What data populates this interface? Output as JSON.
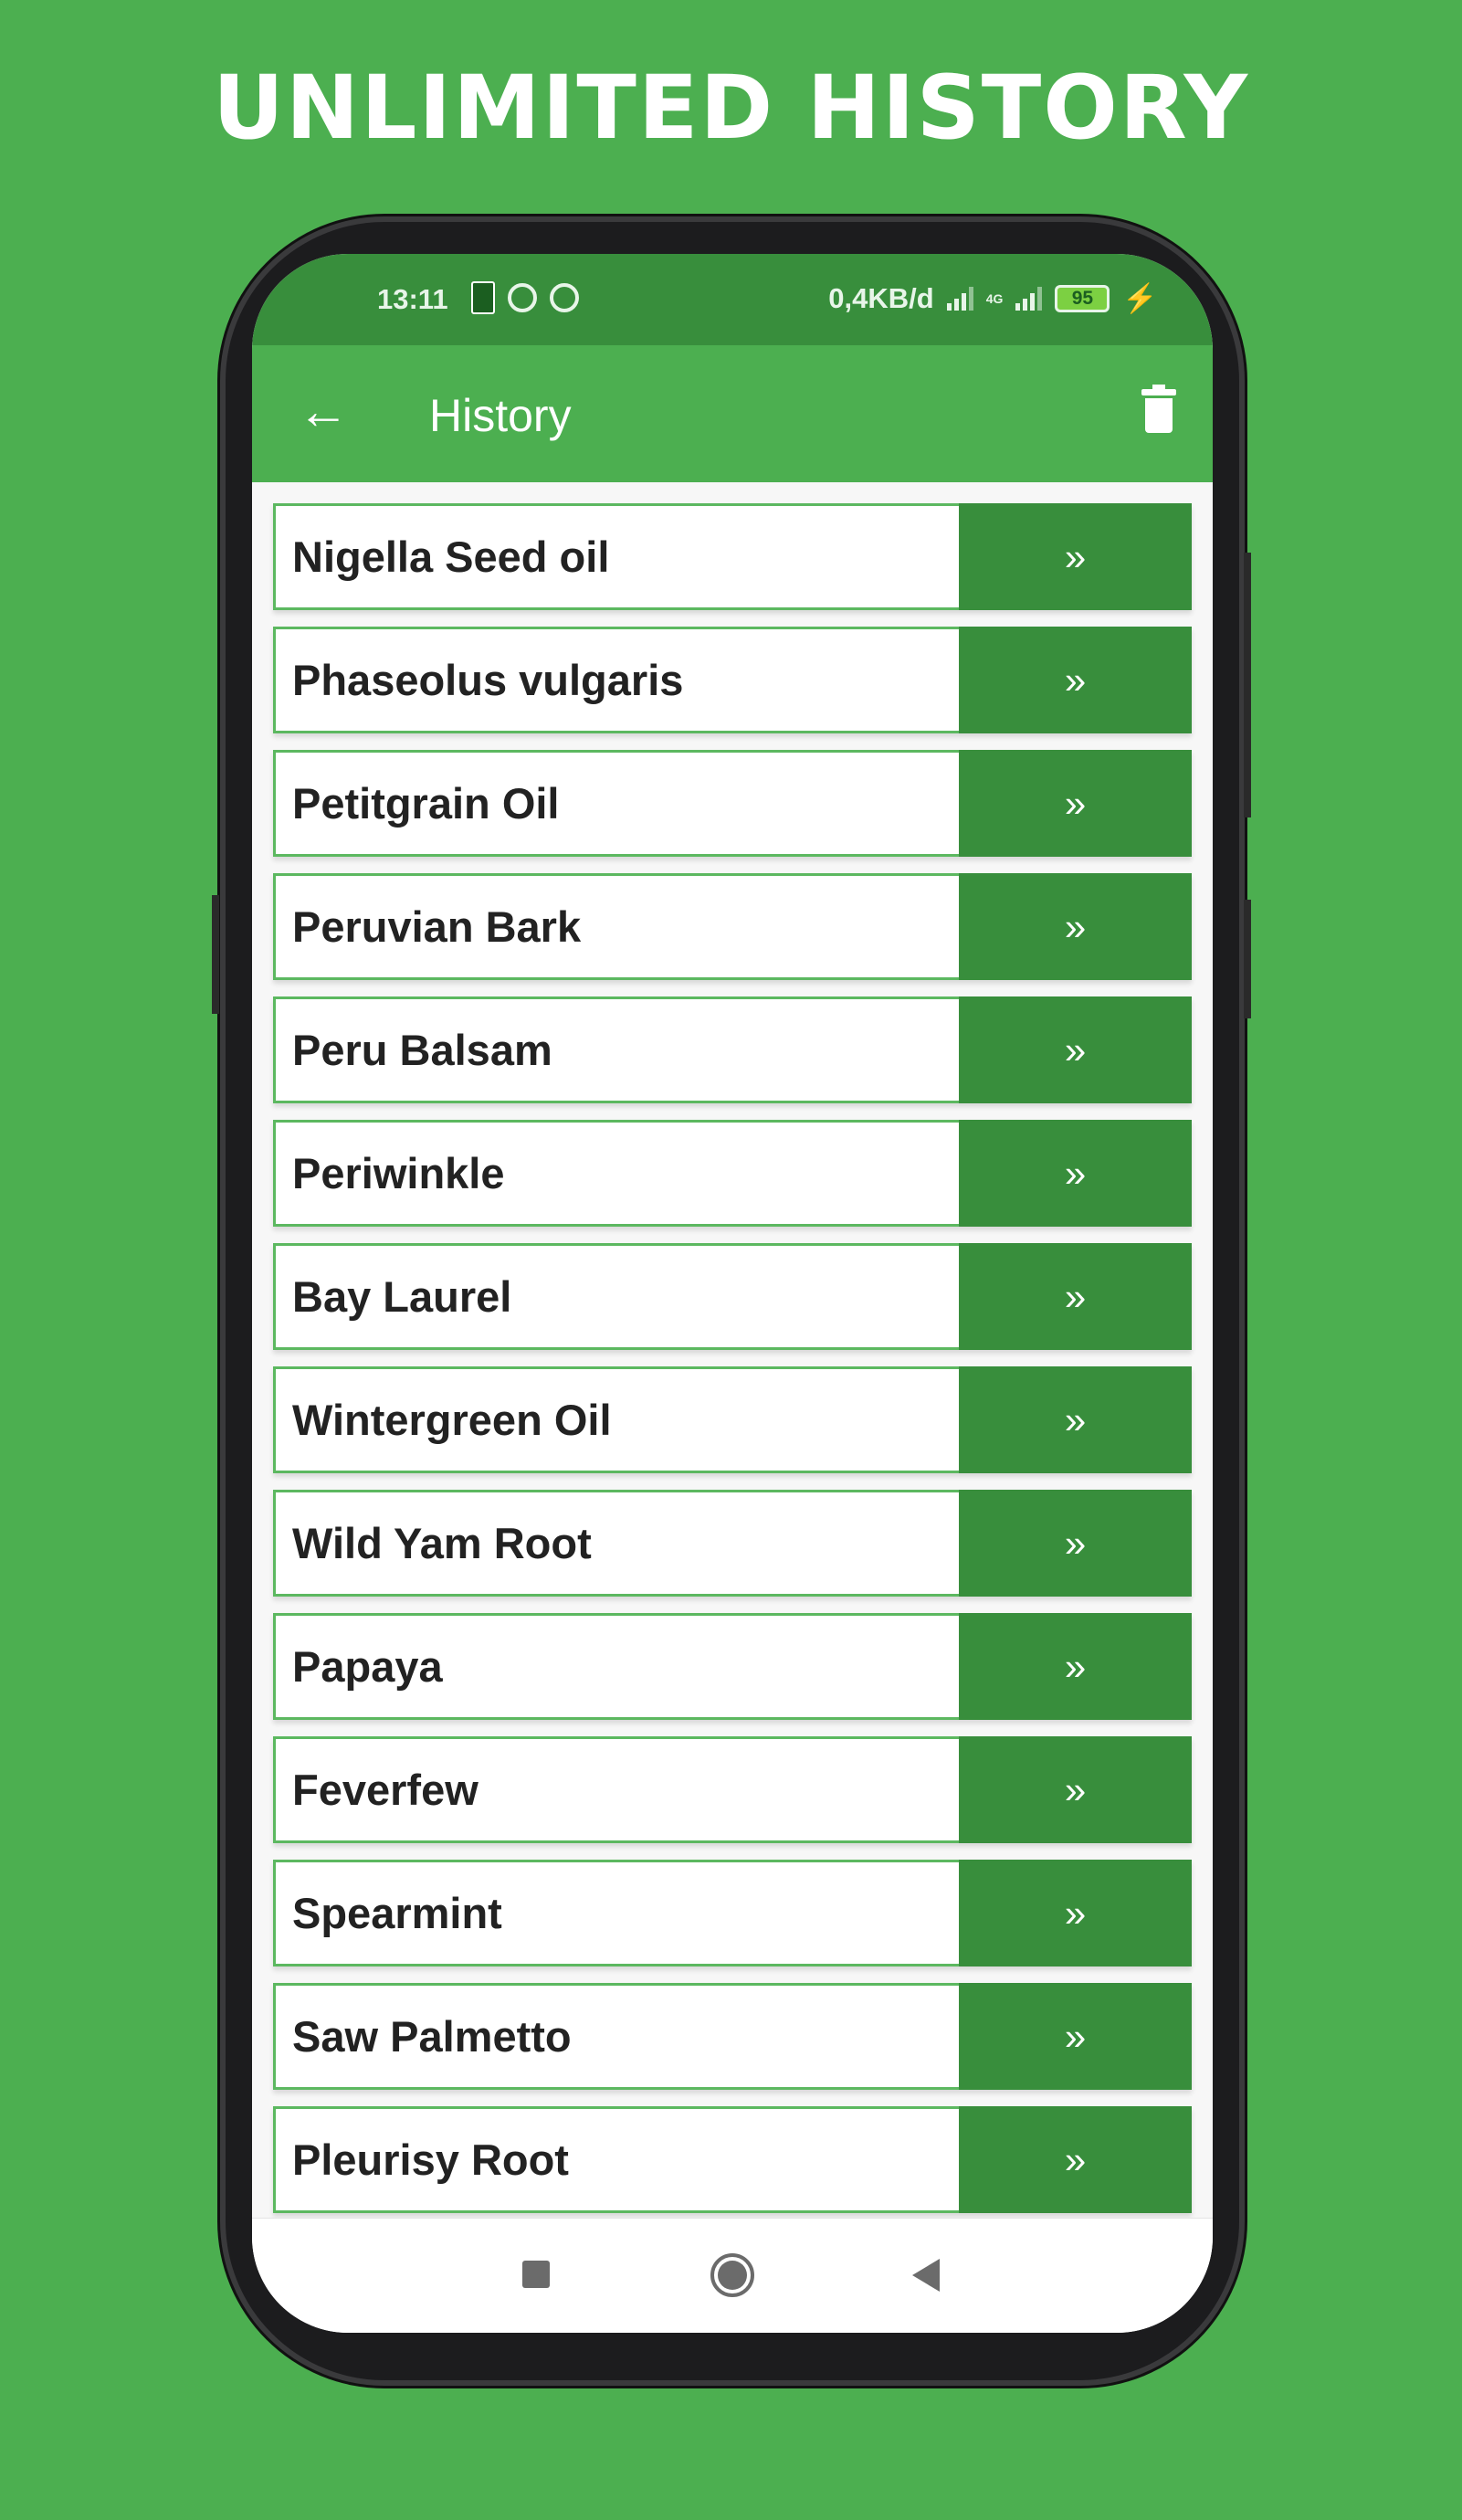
{
  "headline": "UNLIMITED HISTORY",
  "status": {
    "time": "13:11",
    "data_rate": "0,4KB/d",
    "network": "4G",
    "battery": "95"
  },
  "appbar": {
    "back_icon": "←",
    "title": "History"
  },
  "items": [
    {
      "label": "Nigella Seed oil",
      "action": "»"
    },
    {
      "label": "Phaseolus vulgaris",
      "action": "»"
    },
    {
      "label": "Petitgrain Oil",
      "action": "»"
    },
    {
      "label": "Peruvian Bark",
      "action": "»"
    },
    {
      "label": "Peru Balsam",
      "action": "»"
    },
    {
      "label": "Periwinkle",
      "action": "»"
    },
    {
      "label": "Bay Laurel",
      "action": "»"
    },
    {
      "label": "Wintergreen Oil",
      "action": "»"
    },
    {
      "label": "Wild Yam Root",
      "action": "»"
    },
    {
      "label": "Papaya",
      "action": "»"
    },
    {
      "label": "Feverfew",
      "action": "»"
    },
    {
      "label": "Spearmint",
      "action": "»"
    },
    {
      "label": "Saw Palmetto",
      "action": "»"
    },
    {
      "label": "Pleurisy Root",
      "action": "»"
    }
  ],
  "colors": {
    "background": "#4caf50",
    "status_bar": "#388e3c",
    "app_bar": "#4caf50",
    "action_button": "#388e3c"
  }
}
